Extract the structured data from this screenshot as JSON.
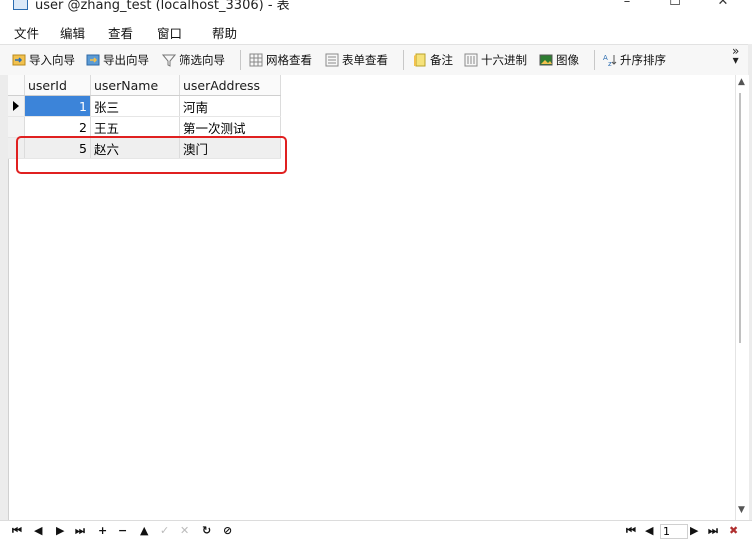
{
  "window": {
    "title": "user @zhang_test (localhost_3306) - 表",
    "minimize": "–",
    "maximize": "☐",
    "close": "✕"
  },
  "menu": [
    "文件",
    "编辑",
    "查看",
    "窗口",
    "帮助"
  ],
  "toolbar": {
    "import_wizard": "导入向导",
    "export_wizard": "导出向导",
    "filter_wizard": "筛选向导",
    "grid_view": "网格查看",
    "form_view": "表单查看",
    "memo": "备注",
    "hex": "十六进制",
    "image": "图像",
    "sort_asc": "升序排序",
    "more": "»"
  },
  "grid": {
    "columns": [
      "userId",
      "userName",
      "userAddress"
    ],
    "rows": [
      {
        "userId": "1",
        "userName": "张三",
        "userAddress": "河南"
      },
      {
        "userId": "2",
        "userName": "王五",
        "userAddress": "第一次测试"
      },
      {
        "userId": "5",
        "userName": "赵六",
        "userAddress": "澳门"
      }
    ]
  },
  "navigation": {
    "first": "⏮",
    "prev": "◀",
    "next": "▶",
    "last": "⏭",
    "add": "+",
    "delete": "−",
    "up": "▲",
    "apply": "✓",
    "cancel": "✕",
    "refresh": "↻",
    "stop": "⊘",
    "page_value": "1"
  },
  "colors": {
    "selected_header": "#3c84d9",
    "highlight_box": "#e02020"
  }
}
